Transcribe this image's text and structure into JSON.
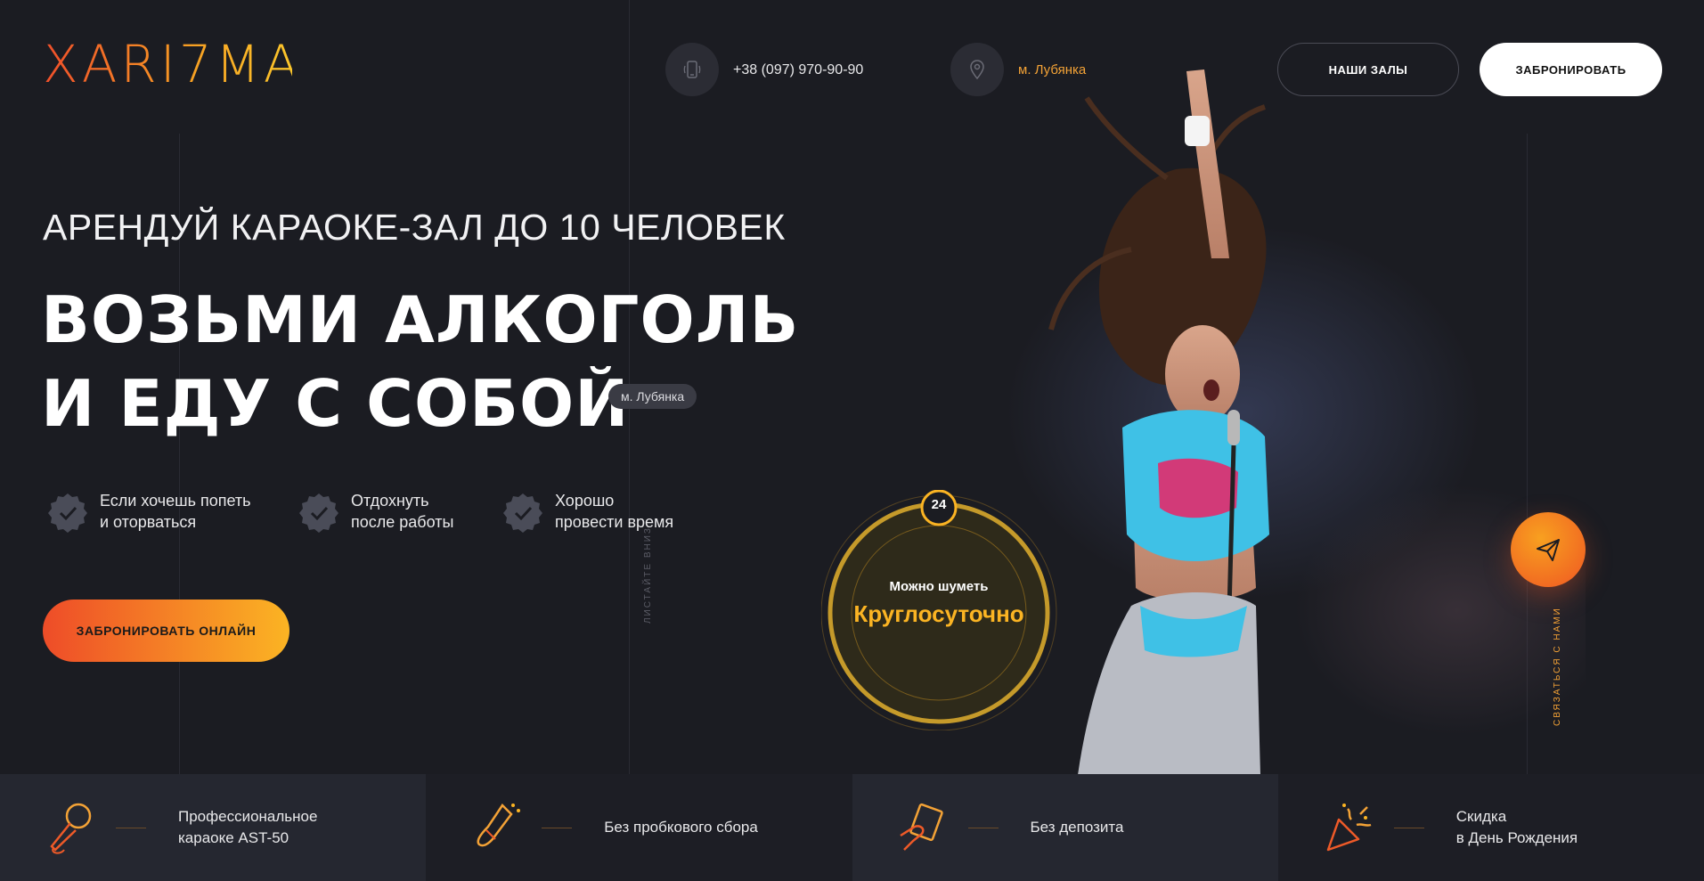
{
  "header": {
    "logo": "XARI7MA",
    "phone": "+38 (097) 970-90-90",
    "metro": "м. Лубянка",
    "halls_button": "НАШИ ЗАЛЫ",
    "book_button": "ЗАБРОНИРОВАТЬ"
  },
  "hero": {
    "subtitle": "АРЕНДУЙ КАРАОКЕ-ЗАЛ ДО 10 ЧЕЛОВЕК",
    "headline_line1": "ВОЗЬМИ АЛКОГОЛЬ",
    "headline_line2": "И ЕДУ С СОБОЙ",
    "metro_badge": "м. Лубянка",
    "features": [
      {
        "line1": "Если хочешь попеть",
        "line2": "и оторваться"
      },
      {
        "line1": "Отдохнуть",
        "line2": "после работы"
      },
      {
        "line1": "Хорошо",
        "line2": "провести время"
      }
    ],
    "cta": "ЗАБРОНИРОВАТЬ ОНЛАЙН",
    "scroll_hint": "ЛИСТАЙТЕ ВНИЗ",
    "contact_hint": "СВЯЗАТЬСЯ С НАМИ"
  },
  "round_badge": {
    "number": "24",
    "line1": "Можно шуметь",
    "line2": "Круглосуточно"
  },
  "benefits": [
    {
      "icon": "microphone-icon",
      "line1": "Профессиональное",
      "line2": "караоке AST-50"
    },
    {
      "icon": "champagne-icon",
      "line1": "Без пробкового сбора",
      "line2": ""
    },
    {
      "icon": "money-hand-icon",
      "line1": "Без депозита",
      "line2": ""
    },
    {
      "icon": "party-popper-icon",
      "line1": "Скидка",
      "line2": "в День Рождения"
    }
  ],
  "colors": {
    "background": "#1b1c22",
    "accent_orange": "#f3a236",
    "accent_red": "#ee4c28",
    "accent_yellow": "#fbb423"
  }
}
